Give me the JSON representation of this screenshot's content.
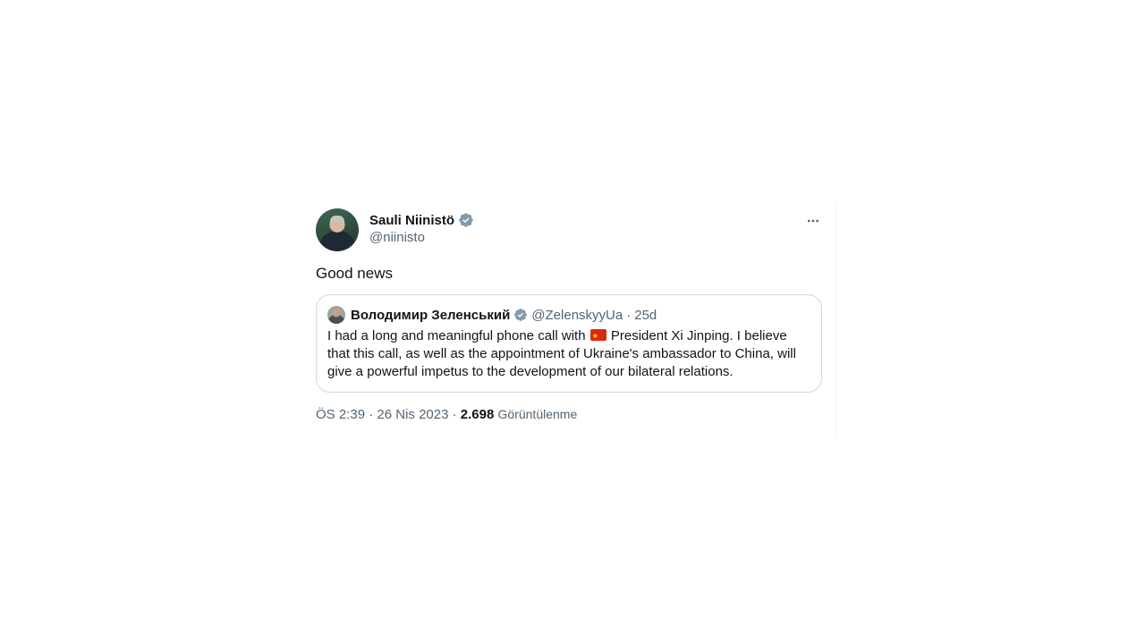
{
  "tweet": {
    "display_name": "Sauli Niinistö",
    "handle": "@niinisto",
    "text": "Good news",
    "more_icon": "more-horizontal-icon",
    "verified_icon": "verified-badge-icon"
  },
  "quote": {
    "display_name": "Володимир Зеленський",
    "handle": "@ZelenskyyUa",
    "separator": "·",
    "time": "25d",
    "text_part1": "I had a long and meaningful phone call with ",
    "flag_icon": "china-flag-icon",
    "text_part2": " President Xi Jinping. I believe that this call, as well as the appointment of Ukraine's ambassador to China, will give a powerful impetus to the development of our bilateral relations."
  },
  "meta": {
    "time": "ÖS 2:39",
    "separator1": "·",
    "date": "26 Nis 2023",
    "separator2": "·",
    "views_count": "2.698",
    "views_label": "Görüntülenme"
  },
  "colors": {
    "primary_text": "#0f1419",
    "secondary_text": "#536471",
    "border": "#cfd9de",
    "verified": "#829aab"
  }
}
